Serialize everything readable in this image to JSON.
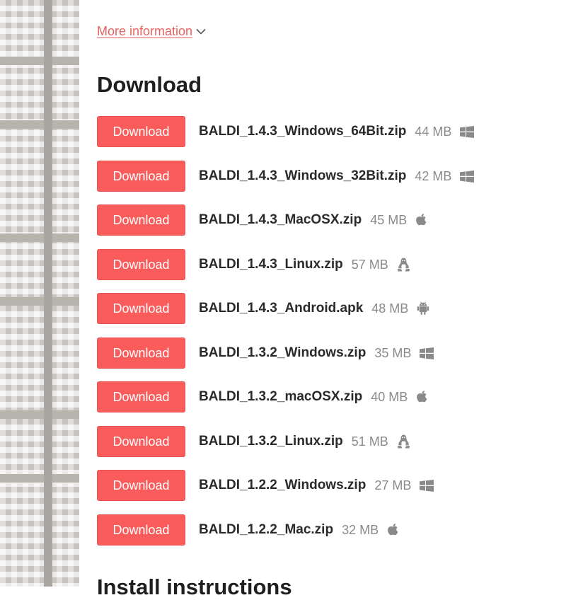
{
  "more_info": {
    "label": "More information",
    "icon": "chevron-down-icon",
    "color": "#e8635f"
  },
  "download_section": {
    "title": "Download",
    "button_color": "#fa5c5c",
    "uploads": [
      {
        "button_label": "Download",
        "filename": "BALDI_1.4.3_Windows_64Bit.zip",
        "size": "44 MB",
        "platform_icon": "windows-icon"
      },
      {
        "button_label": "Download",
        "filename": "BALDI_1.4.3_Windows_32Bit.zip",
        "size": "42 MB",
        "platform_icon": "windows-icon"
      },
      {
        "button_label": "Download",
        "filename": "BALDI_1.4.3_MacOSX.zip",
        "size": "45 MB",
        "platform_icon": "apple-icon"
      },
      {
        "button_label": "Download",
        "filename": "BALDI_1.4.3_Linux.zip",
        "size": "57 MB",
        "platform_icon": "linux-icon"
      },
      {
        "button_label": "Download",
        "filename": "BALDI_1.4.3_Android.apk",
        "size": "48 MB",
        "platform_icon": "android-icon"
      },
      {
        "button_label": "Download",
        "filename": "BALDI_1.3.2_Windows.zip",
        "size": "35 MB",
        "platform_icon": "windows-icon"
      },
      {
        "button_label": "Download",
        "filename": "BALDI_1.3.2_macOSX.zip",
        "size": "40 MB",
        "platform_icon": "apple-icon"
      },
      {
        "button_label": "Download",
        "filename": "BALDI_1.3.2_Linux.zip",
        "size": "51 MB",
        "platform_icon": "linux-icon"
      },
      {
        "button_label": "Download",
        "filename": "BALDI_1.2.2_Windows.zip",
        "size": "27 MB",
        "platform_icon": "windows-icon"
      },
      {
        "button_label": "Download",
        "filename": "BALDI_1.2.2_Mac.zip",
        "size": "32 MB",
        "platform_icon": "apple-icon"
      }
    ]
  },
  "install_section": {
    "title": "Install instructions"
  }
}
